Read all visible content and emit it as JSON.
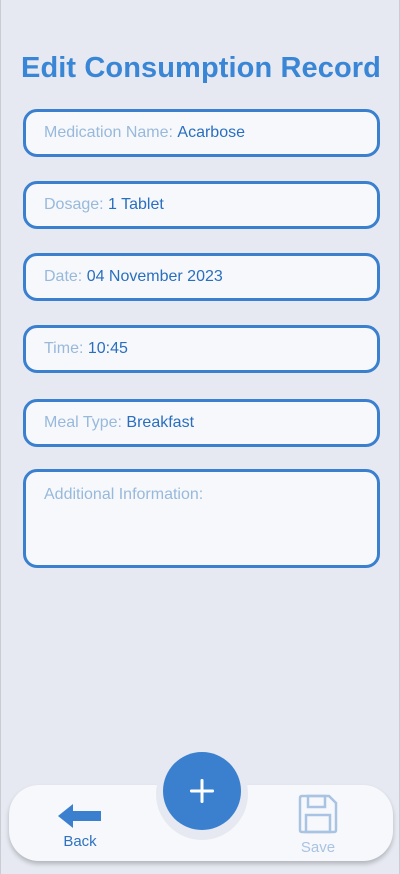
{
  "page": {
    "title": "Edit Consumption Record"
  },
  "form": {
    "medication_label": "Medication Name: ",
    "medication_value": "Acarbose",
    "dosage_label": "Dosage: ",
    "dosage_value": "1 Tablet",
    "date_label": "Date: ",
    "date_value": "04 November 2023",
    "time_label": "Time: ",
    "time_value": "10:45",
    "meal_label": "Meal Type: ",
    "meal_value": "Breakfast",
    "info_placeholder": "Additional Information:"
  },
  "nav": {
    "back_label": "Back",
    "save_label": "Save",
    "add_icon": "plus-icon",
    "back_icon": "arrow-left-icon",
    "save_icon": "floppy-disk-icon"
  },
  "colors": {
    "accent": "#3a80cf",
    "title": "#3a86d6",
    "label": "#98b9dc",
    "value": "#2a6fbf",
    "background": "#e6e9f1",
    "field_background": "#f6f8fb",
    "save_disabled": "#a9c3e3"
  }
}
